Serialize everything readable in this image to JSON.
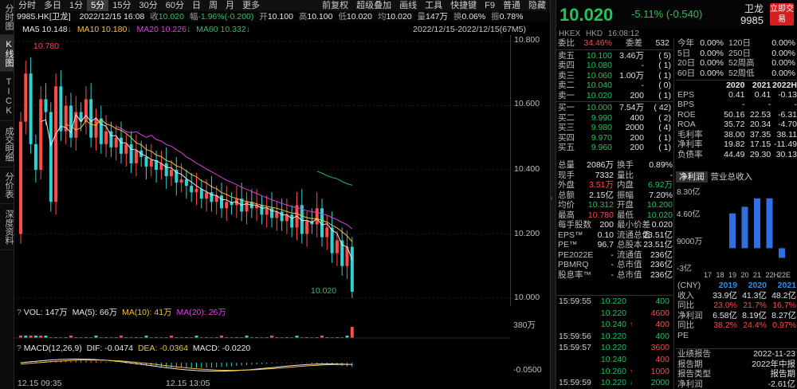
{
  "left_tabs": [
    "分时图",
    "K线图",
    "TICK",
    "成交明细",
    "分价表",
    "深度资料"
  ],
  "toolbar": {
    "periods": [
      "分时",
      "多日",
      "1分",
      "5分",
      "15分",
      "30分",
      "60分",
      "日",
      "周",
      "月",
      "更多"
    ],
    "active_period": "5分",
    "tools": [
      "前复权",
      "超级叠加",
      "画线",
      "工具",
      "快捷键",
      "F9",
      "普通",
      "隐藏"
    ]
  },
  "info": {
    "symbol": "9985.HK[卫龙]",
    "datetime": "2022/12/15 16:08",
    "close_label": "收",
    "close": "10.020",
    "amp_label": "幅",
    "amp": "-1.96%(-0.200)",
    "open_label": "开",
    "open": "10.100",
    "high_label": "高",
    "high": "10.100",
    "low_label": "低",
    "low": "10.020",
    "avg_label": "均",
    "avg": "10.020",
    "vol_label": "量",
    "vol": "147万",
    "turnover_label": "换",
    "turnover": "0.06%",
    "swing_label": "振",
    "swing": "0.78%"
  },
  "ma": {
    "ma5_label": "MA5",
    "ma5": "10.148",
    "ma10_label": "MA10",
    "ma10": "10.180",
    "ma20_label": "MA20",
    "ma20": "10.226",
    "ma60_label": "MA60",
    "ma60": "10.332",
    "range": "2022/12/15-2022/12/15(67M5)"
  },
  "price_axis": [
    "10.800",
    "10.600",
    "10.400",
    "10.200",
    "10.000"
  ],
  "chart_labels": {
    "max": "10.780",
    "min": "10.020"
  },
  "volume": {
    "label": "VOL: 147万",
    "ma5": "MA(5): 66万",
    "ma10": "MA(10): 41万",
    "ma20": "MA(20): 26万",
    "axis": "380万"
  },
  "macd": {
    "label": "MACD(12,26,9)",
    "dif": "DIF: -0.0474",
    "dea": "DEA: -0.0364",
    "macd": "MACD: -0.0220",
    "axis": "-0.0500"
  },
  "xaxis": [
    "12.15 09:35",
    "12.15 13:05"
  ],
  "quote": {
    "price": "10.020",
    "change": "-5.11% (-0.540)",
    "name": "卫龙",
    "code": "9985",
    "trade_btn": "立即交易",
    "market": "HKEX",
    "currency": "HKD",
    "time": "16:08:12"
  },
  "orderbook": {
    "ratio_label": "委比",
    "ratio": "34.46%",
    "diff_label": "委差",
    "diff": "532",
    "asks": [
      {
        "label": "卖五",
        "price": "10.100",
        "vol": "3.46万",
        "cnt": "( 5)"
      },
      {
        "label": "卖四",
        "price": "10.080",
        "vol": "-",
        "cnt": "( 1)"
      },
      {
        "label": "卖三",
        "price": "10.060",
        "vol": "1.00万",
        "cnt": "( 1)"
      },
      {
        "label": "卖二",
        "price": "10.040",
        "vol": "-",
        "cnt": "( 0)"
      },
      {
        "label": "卖一",
        "price": "10.020",
        "vol": "200",
        "cnt": "( 1)"
      }
    ],
    "bids": [
      {
        "label": "买一",
        "price": "10.000",
        "vol": "7.54万",
        "cnt": "( 42)"
      },
      {
        "label": "买二",
        "price": "9.990",
        "vol": "400",
        "cnt": "( 2)"
      },
      {
        "label": "买三",
        "price": "9.980",
        "vol": "2000",
        "cnt": "( 4)"
      },
      {
        "label": "买四",
        "price": "9.970",
        "vol": "200",
        "cnt": "( 1)"
      },
      {
        "label": "买五",
        "price": "9.960",
        "vol": "200",
        "cnt": "( 1)"
      }
    ]
  },
  "stats": [
    {
      "k": "总量",
      "v": "2086万",
      "vc": "white",
      "k2": "换手",
      "v2": "0.89%",
      "v2c": "white"
    },
    {
      "k": "现手",
      "v": "7332",
      "vc": "white",
      "k2": "量比",
      "v2": "-",
      "v2c": "white"
    },
    {
      "k": "外盘",
      "v": "3.51万",
      "vc": "red",
      "k2": "内盘",
      "v2": "6.92万",
      "v2c": "green"
    },
    {
      "k": "总额",
      "v": "2.15亿",
      "vc": "white",
      "k2": "振幅",
      "v2": "7.20%",
      "v2c": "white"
    },
    {
      "k": "均价",
      "v": "10.312",
      "vc": "green",
      "k2": "开盘",
      "v2": "10.200",
      "v2c": "green"
    },
    {
      "k": "最高",
      "v": "10.780",
      "vc": "red",
      "k2": "最低",
      "v2": "10.020",
      "v2c": "green"
    },
    {
      "k": "每手股数",
      "v": "200",
      "vc": "white",
      "k2": "最小价差",
      "v2": "0.020",
      "v2c": "white"
    },
    {
      "k": "EPS™",
      "v": "0.10",
      "vc": "white",
      "k2": "流通总值",
      "v2": "23.51亿",
      "v2c": "white"
    },
    {
      "k": "PE™",
      "v": "96.7",
      "vc": "white",
      "k2": "总股本",
      "v2": "23.51亿",
      "v2c": "white"
    },
    {
      "k": "PE2022E",
      "v": "-",
      "vc": "white",
      "k2": "流通值",
      "v2": "236亿",
      "v2c": "white"
    },
    {
      "k": "PBMRQ",
      "v": "-",
      "vc": "white",
      "k2": "总市值",
      "v2": "236亿",
      "v2c": "white"
    },
    {
      "k": "股息率™",
      "v": "-",
      "vc": "white",
      "k2": "总市值",
      "v2": "236亿",
      "v2c": "white"
    }
  ],
  "ticks": [
    {
      "t": "15:59:55",
      "p": "10.220",
      "ar": "",
      "q": "400",
      "qc": "green"
    },
    {
      "t": "",
      "p": "10.220",
      "ar": "",
      "q": "4600",
      "qc": "red"
    },
    {
      "t": "",
      "p": "10.240",
      "ar": "↑",
      "q": "400",
      "qc": "red"
    },
    {
      "t": "15:59:56",
      "p": "10.220",
      "ar": "",
      "q": "400",
      "qc": "green"
    },
    {
      "t": "15:59:57",
      "p": "10.220",
      "ar": "",
      "q": "3600",
      "qc": "red"
    },
    {
      "t": "",
      "p": "10.240",
      "ar": "",
      "q": "400",
      "qc": "red"
    },
    {
      "t": "",
      "p": "10.260",
      "ar": "↑",
      "q": "1000",
      "qc": "red"
    },
    {
      "t": "15:59:59",
      "p": "10.220",
      "ar": "↓",
      "q": "2000",
      "qc": "green"
    }
  ],
  "perf": [
    {
      "k": "今年",
      "v": "0.00%",
      "k3": "120日",
      "v3": "0.00%"
    },
    {
      "k": "5日",
      "v": "0.00%",
      "k3": "250日",
      "v3": "0.00%"
    },
    {
      "k": "20日",
      "v": "0.00%",
      "k3": "52周高",
      "v3": "0.00%"
    },
    {
      "k": "60日",
      "v": "0.00%",
      "k3": "52周低",
      "v3": "0.00%"
    }
  ],
  "fundamentals": {
    "years": [
      "2020",
      "2021",
      "2022H"
    ],
    "rows": [
      {
        "k": "EPS",
        "v": [
          "0.41",
          "0.41",
          "-0.13"
        ]
      },
      {
        "k": "BPS",
        "v": [
          "-",
          "-",
          "-"
        ]
      },
      {
        "k": "ROE",
        "v": [
          "50.16",
          "22.53",
          "-6.31"
        ]
      },
      {
        "k": "ROA",
        "v": [
          "35.72",
          "20.34",
          "-4.70"
        ]
      },
      {
        "k": "毛利率",
        "v": [
          "38.00",
          "37.35",
          "38.11"
        ]
      },
      {
        "k": "净利率",
        "v": [
          "19.82",
          "17.15",
          "-11.49"
        ]
      },
      {
        "k": "负债率",
        "v": [
          "44.49",
          "29.30",
          "30.13"
        ]
      }
    ]
  },
  "revenue_tabs": [
    "净利润",
    "营业总收入"
  ],
  "chart_data": {
    "type": "bar",
    "categories": [
      "17",
      "18",
      "19",
      "20",
      "21",
      "22H",
      "22E"
    ],
    "values": [
      0,
      0,
      5.8,
      6.9,
      8.3,
      8.3,
      -1.6
    ],
    "ylabels": [
      "8.30亿",
      "4.60亿",
      "9000万",
      "-3亿"
    ],
    "colors": {
      "pos": "#2f6fe0",
      "neg": "#2f6fe0"
    }
  },
  "income": {
    "unit": "(CNY)",
    "years": [
      "2019",
      "2020",
      "2021"
    ],
    "rows": [
      {
        "k": "收入",
        "v": [
          "33.9亿",
          "41.3亿",
          "48.2亿"
        ],
        "c": "white"
      },
      {
        "k": "同比",
        "v": [
          "23.0%",
          "21.7%",
          "16.7%"
        ],
        "c": "red"
      },
      {
        "k": "净利润",
        "v": [
          "6.58亿",
          "8.19亿",
          "8.27亿"
        ],
        "c": "white"
      },
      {
        "k": "同比",
        "v": [
          "38.2%",
          "24.4%",
          "0.97%"
        ],
        "c": "red"
      },
      {
        "k": "PE",
        "v": [
          "",
          "",
          ""
        ],
        "c": "white"
      }
    ]
  },
  "report": [
    {
      "k": "业绩报告",
      "v": "2022-11-23"
    },
    {
      "k": "报告期",
      "v": "2022年中报"
    },
    {
      "k": "报告类型",
      "v": "报告期"
    },
    {
      "k": "净利润",
      "v": "-2.61亿"
    }
  ]
}
